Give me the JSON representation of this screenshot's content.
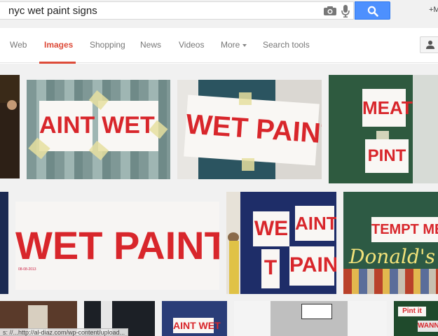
{
  "search": {
    "query": "nyc wet paint signs"
  },
  "header": {
    "plus_link": "+M"
  },
  "tabs": [
    {
      "label": "Web"
    },
    {
      "label": "Images",
      "active": true
    },
    {
      "label": "Shopping"
    },
    {
      "label": "News"
    },
    {
      "label": "Videos"
    },
    {
      "label": "More"
    },
    {
      "label": "Search tools"
    }
  ],
  "images": [
    {
      "sign_words": [
        "AINT",
        "WET"
      ]
    },
    {
      "sign_words": [
        "WET PAINT"
      ]
    },
    {
      "sign_words": [
        "MEAT",
        "PINT"
      ]
    },
    {
      "sign_words": [
        "WET PAINT"
      ],
      "caption": "08-08-2013"
    },
    {
      "sign_words": [
        "WE",
        "AINT",
        "T",
        "PAIN"
      ]
    },
    {
      "sign_words": [
        "TEMPT ME",
        "Donald's"
      ]
    },
    {
      "sign_words": [
        "AINT WET"
      ]
    },
    {
      "sign_words": [
        "Pint it",
        "WANN"
      ]
    }
  ],
  "status_url": "s: //...http://al-diaz.com/wp-content/upload...",
  "colors": {
    "accent": "#dd4b39",
    "search_button": "#4d90fe",
    "sign_red": "#d8262b"
  }
}
